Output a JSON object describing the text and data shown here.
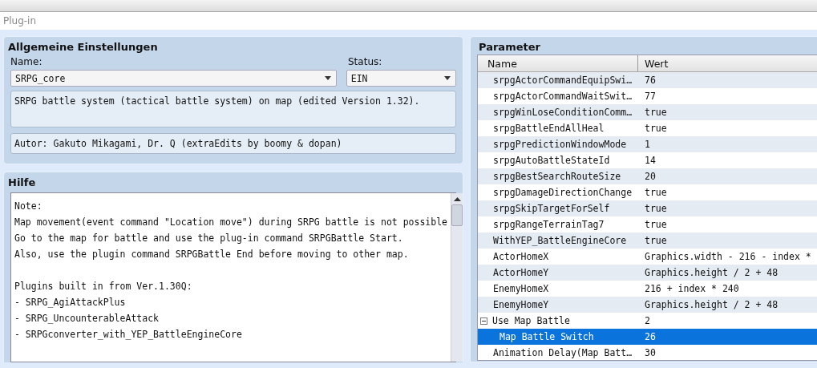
{
  "window": {
    "title": "Plug-in"
  },
  "general": {
    "title": "Allgemeine Einstellungen",
    "name_label": "Name:",
    "name_value": "SRPG_core",
    "status_label": "Status:",
    "status_value": "EIN",
    "description": "SRPG battle system (tactical battle system) on map (edited Version 1.32).",
    "author": "Autor: Gakuto Mikagami, Dr. Q (extraEdits by boomy & dopan)"
  },
  "help": {
    "title": "Hilfe",
    "paragraphs": [
      [
        "Note:",
        "Map movement(event command \"Location move\") during SRPG battle is not possible",
        "Go to the map for battle and use the plug-in command SRPGBattle Start.",
        "Also, use the plugin command SRPGBattle End before moving to other map."
      ],
      [
        "Plugins built in from Ver.1.30Q:",
        "- SRPG_AgiAttackPlus",
        "- SRPG_UncounterableAttack",
        "- SRPGconverter_with_YEP_BattleEngineCore"
      ]
    ]
  },
  "parameters": {
    "title": "Parameter",
    "columns": [
      "Name",
      "Wert"
    ],
    "rows": [
      {
        "name": "srpgActorCommandEquipSwi…",
        "value": "76",
        "selected": false
      },
      {
        "name": "srpgActorCommandWaitSwit…",
        "value": "77",
        "selected": false
      },
      {
        "name": "srpgWinLoseConditionComm…",
        "value": "true",
        "selected": false
      },
      {
        "name": "srpgBattleEndAllHeal",
        "value": "true",
        "selected": false
      },
      {
        "name": "srpgPredictionWindowMode",
        "value": "1",
        "selected": false
      },
      {
        "name": "srpgAutoBattleStateId",
        "value": "14",
        "selected": false
      },
      {
        "name": "srpgBestSearchRouteSize",
        "value": "20",
        "selected": false
      },
      {
        "name": "srpgDamageDirectionChange",
        "value": "true",
        "selected": false
      },
      {
        "name": "srpgSkipTargetForSelf",
        "value": "true",
        "selected": false
      },
      {
        "name": "srpgRangeTerrainTag7",
        "value": "true",
        "selected": false
      },
      {
        "name": "WithYEP_BattleEngineCore",
        "value": "true",
        "selected": false
      },
      {
        "name": "ActorHomeX",
        "value": "Graphics.width - 216 - index *",
        "selected": false
      },
      {
        "name": "ActorHomeY",
        "value": "Graphics.height / 2 + 48",
        "selected": false
      },
      {
        "name": "EnemyHomeX",
        "value": "216 + index * 240",
        "selected": false
      },
      {
        "name": "EnemyHomeY",
        "value": "Graphics.height / 2 + 48",
        "selected": false
      },
      {
        "name": "Use Map Battle",
        "value": "2",
        "selected": false,
        "expanded": true,
        "children": [
          {
            "name": "Map Battle Switch",
            "value": "26",
            "selected": true
          }
        ]
      },
      {
        "name": "Animation Delay(Map Batt…",
        "value": "30",
        "selected": false
      }
    ]
  }
}
